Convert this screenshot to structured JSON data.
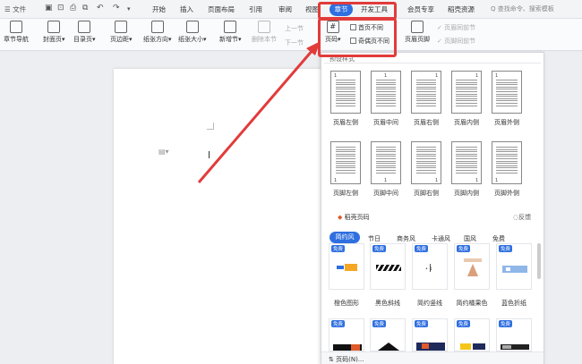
{
  "tabbar": {
    "menu_label": "☰ 文件",
    "tabs": [
      "开始",
      "插入",
      "页面布局",
      "引用",
      "审阅",
      "视图",
      "章节",
      "开发工具",
      "会员专享",
      "稻壳资源"
    ],
    "active_tab": "章节",
    "search_placeholder": "Q 查找命令、搜索模板"
  },
  "ribbon": {
    "chapter_nav": "章节导航",
    "cover_page": "封面页▾",
    "toc_page": "目录页▾",
    "margins": "页边距▾",
    "orientation": "纸张方向▾",
    "paper_size": "纸张大小▾",
    "new_section": "新增节▾",
    "delete_section": "删除本节",
    "prev_section": "上一节",
    "next_section": "下一节",
    "page_number": "页码▾",
    "first_page_diff": "首页不同",
    "odd_even_diff": "奇偶页不同",
    "header_footer": "页眉页脚",
    "link_prev_header": "页眉同前节",
    "link_prev_footer": "页脚同前节"
  },
  "panel": {
    "preset_title": "预设样式",
    "header_row": [
      "页眉左侧",
      "页眉中间",
      "页眉右侧",
      "页眉内侧",
      "页眉外侧"
    ],
    "footer_row": [
      "页脚左侧",
      "页脚中间",
      "页脚右侧",
      "页脚内侧",
      "页脚外侧"
    ],
    "thumb_number": "1",
    "daoke_title": "稻壳页码",
    "feedback": "反馈",
    "filter_tabs": [
      "简约风",
      "节日",
      "商务风",
      "卡通风",
      "国风",
      "免费"
    ],
    "free_badge": "免费",
    "cards": [
      "橙色图形",
      "黑色斜线",
      "简约竖线",
      "简约橘果色",
      "蓝色折纸"
    ],
    "footer_link": "页码(N)..."
  }
}
